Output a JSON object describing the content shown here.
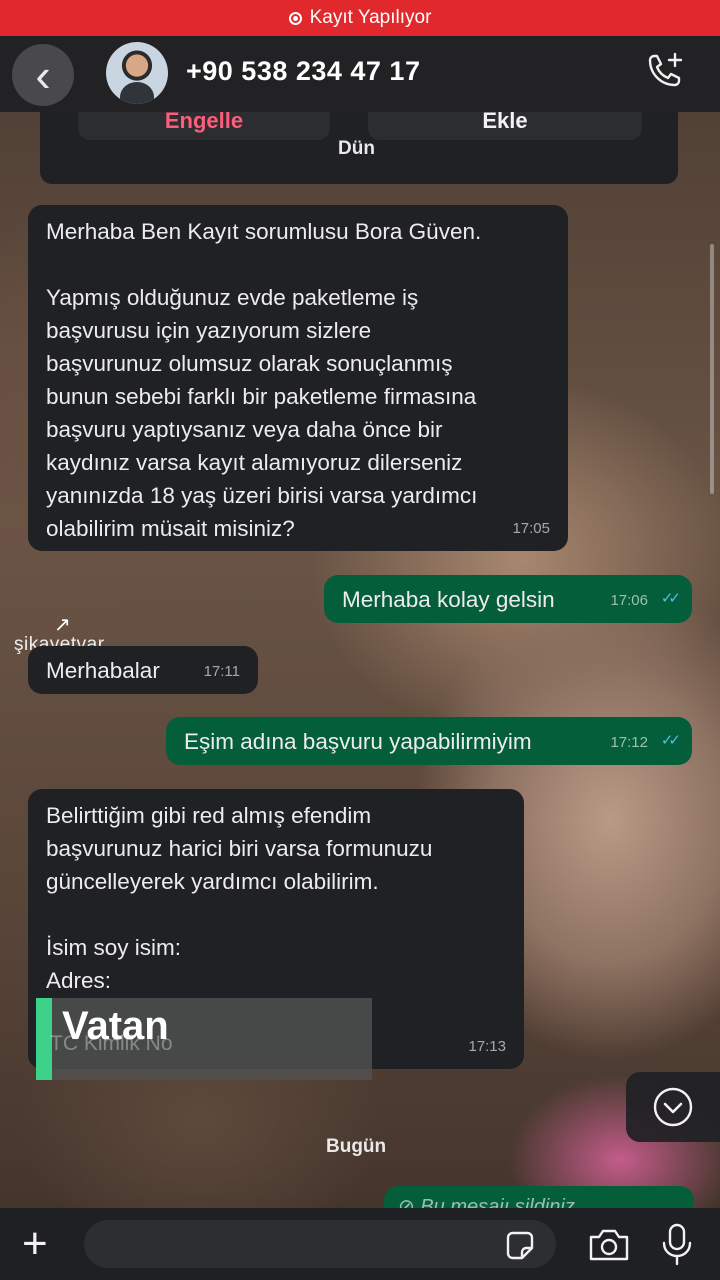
{
  "recording_bar": {
    "label": "Kayıt Yapılıyor"
  },
  "header": {
    "contact_number": "+90 538 234 47 17"
  },
  "top_card": {
    "block_label": "Engelle",
    "add_label": "Ekle"
  },
  "dates": {
    "yesterday": "Dün",
    "today": "Bugün"
  },
  "messages": [
    {
      "direction": "incoming",
      "text": "Merhaba Ben Kayıt sorumlusu Bora Güven.\n\nYapmış olduğunuz evde paketleme iş\nbaşvurusu için yazıyorum sizlere\nbaşvurunuz olumsuz olarak sonuçlanmış\nbunun sebebi farklı bir paketleme firmasına\nbaşvuru yaptıysanız veya daha önce bir\nkaydınız varsa kayıt alamıyoruz dilerseniz\nyanınızda 18 yaş üzeri birisi varsa yardımcı\nolabilirim müsait misiniz?",
      "time": "17:05"
    },
    {
      "direction": "outgoing",
      "text": "Merhaba kolay gelsin",
      "time": "17:06"
    },
    {
      "direction": "incoming",
      "text": "Merhabalar",
      "time": "17:11"
    },
    {
      "direction": "outgoing",
      "text": "Eşim adına başvuru yapabilirmiyim",
      "time": "17:12"
    },
    {
      "direction": "incoming",
      "text": "Belirttiğim gibi red almış efendim\nbaşvurunuz harici biri varsa formunuzu\ngüncelleyerek yardımcı olabilirim.\n\nİsim soy isim:\nAdres:",
      "time": "17:13",
      "partial_hidden_text": "TC Kimlik No"
    }
  ],
  "deleted_message": {
    "text": "Bu mesajı sildiniz"
  },
  "overlays": {
    "vatan_logo": "Vatan",
    "watermark": "şikayetvar"
  },
  "colors": {
    "recording": "#e0282d",
    "outgoing_bubble": "#055e3a",
    "incoming_bubble": "#202124",
    "read_ticks": "#53bdeb"
  }
}
